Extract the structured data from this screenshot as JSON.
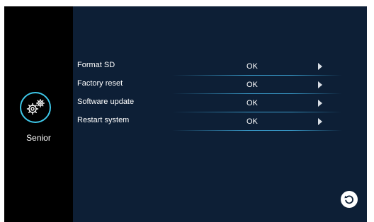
{
  "sidebar": {
    "tile_icon": "gears-icon",
    "tile_label": "Senior",
    "accent": "#3ec7e8"
  },
  "menu": {
    "items": [
      {
        "label": "Format SD",
        "value": "OK"
      },
      {
        "label": "Factory reset",
        "value": "OK"
      },
      {
        "label": "Software update",
        "value": "OK"
      },
      {
        "label": "Restart system",
        "value": "OK"
      }
    ]
  },
  "footer": {
    "back_icon": "back-arrow-icon"
  },
  "colors": {
    "background": "#0d1f36",
    "sidebar": "#000000",
    "text": "#ffffff"
  }
}
